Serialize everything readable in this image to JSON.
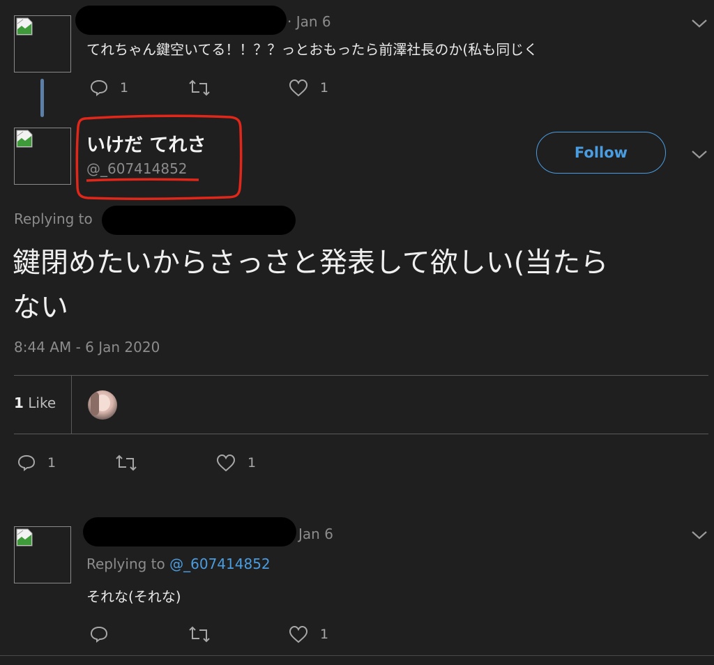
{
  "tweet1": {
    "date": "· Jan 6",
    "text": "てれちゃん鍵空いてる！！？？っとおもったら前澤社長のか(私も同じく",
    "reply_count": "1",
    "like_count": "1"
  },
  "main_tweet": {
    "display_name": "いけだ てれさ",
    "handle": "@_607414852",
    "follow_label": "Follow",
    "replying_to_label": "Replying to",
    "text_line1": "鍵閉めたいからさっさと発表して欲しい(当たら",
    "text_line2": "ない",
    "timestamp": "8:44 AM - 6 Jan 2020",
    "likes_count": "1",
    "likes_label": "Like",
    "reply_count": "1",
    "like_count": "1"
  },
  "tweet3": {
    "date": "Jan 6",
    "replying_to_label": "Replying to",
    "replying_to_handle": "@_607414852",
    "text": "それな(それな)",
    "like_count": "1"
  },
  "colors": {
    "background": "#1f1f20",
    "accent": "#4a9de0",
    "annotation": "#e0271a",
    "thread_line": "#5b7fa6"
  },
  "icons": [
    "reply-icon",
    "retweet-icon",
    "like-icon",
    "chevron-down-icon",
    "broken-image-icon"
  ]
}
